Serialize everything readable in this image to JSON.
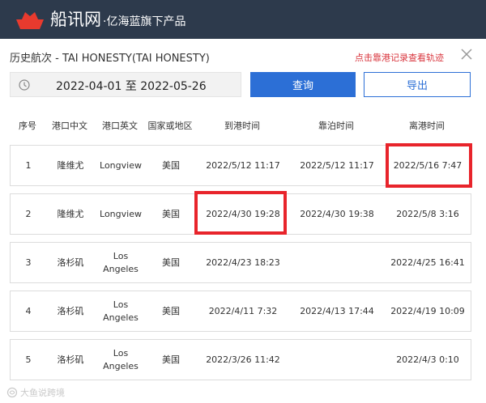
{
  "header": {
    "brand": "船讯网",
    "tagline": "·亿海蓝旗下产品",
    "logo_icon": "ship-logo-icon"
  },
  "panel": {
    "title": "历史航次 - TAI HONESTY(TAI HONESTY)",
    "hint": "点击靠港记录查看轨迹",
    "close_icon": "close-icon"
  },
  "filter": {
    "date_range": "2022-04-01 至 2022-05-26",
    "query_label": "查询",
    "export_label": "导出"
  },
  "table": {
    "columns": [
      "序号",
      "港口中文",
      "港口英文",
      "国家或地区",
      "到港时间",
      "靠泊时间",
      "离港时间"
    ],
    "rows": [
      {
        "no": "1",
        "port_cn": "隆维尤",
        "port_en": "Longview",
        "country": "美国",
        "arrive": "2022/5/12 11:17",
        "berth": "2022/5/12 11:17",
        "depart": "2022/5/16 7:47"
      },
      {
        "no": "2",
        "port_cn": "隆维尤",
        "port_en": "Longview",
        "country": "美国",
        "arrive": "2022/4/30 19:28",
        "berth": "2022/4/30 19:38",
        "depart": "2022/5/8 3:16"
      },
      {
        "no": "3",
        "port_cn": "洛杉矶",
        "port_en": "Los Angeles",
        "country": "美国",
        "arrive": "2022/4/23 18:23",
        "berth": "",
        "depart": "2022/4/25 16:41"
      },
      {
        "no": "4",
        "port_cn": "洛杉矶",
        "port_en": "Los Angeles",
        "country": "美国",
        "arrive": "2022/4/11 7:32",
        "berth": "2022/4/13 17:44",
        "depart": "2022/4/19 10:09"
      },
      {
        "no": "5",
        "port_cn": "洛杉矶",
        "port_en": "Los Angeles",
        "country": "美国",
        "arrive": "2022/3/26 11:42",
        "berth": "",
        "depart": "2022/4/3 0:10"
      }
    ]
  },
  "watermark": "大鱼说跨境",
  "colors": {
    "header_bg": "#2d3a4c",
    "primary": "#2c6fd6",
    "hint_red": "#d9363e",
    "highlight_red": "#e8242b"
  }
}
